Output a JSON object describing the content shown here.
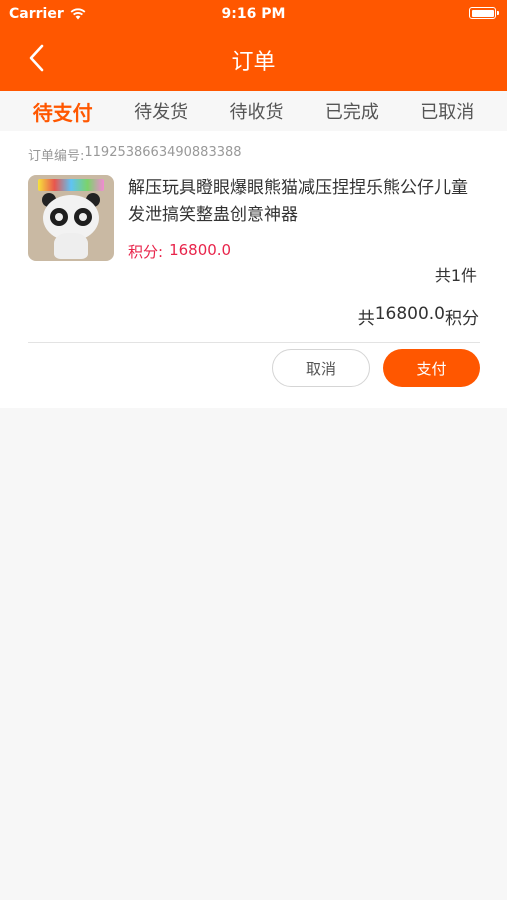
{
  "status_bar": {
    "carrier": "Carrier",
    "time": "9:16 PM"
  },
  "nav": {
    "title": "订单"
  },
  "tabs": [
    {
      "label": "待支付",
      "active": true
    },
    {
      "label": "待发货",
      "active": false
    },
    {
      "label": "待收货",
      "active": false
    },
    {
      "label": "已完成",
      "active": false
    },
    {
      "label": "已取消",
      "active": false
    }
  ],
  "order": {
    "number_label": "订单编号:",
    "number": "1192538663490883388",
    "product_name": "解压玩具瞪眼爆眼熊猫减压捏捏乐熊公仔儿童发泄搞笑整蛊创意神器",
    "points_label": "积分:",
    "points_value": "16800.0",
    "quantity": "共1件",
    "total_prefix": "共",
    "total_value": "16800.0",
    "total_suffix": "积分",
    "cancel_label": "取消",
    "pay_label": "支付"
  },
  "colors": {
    "accent": "#ff5700",
    "points": "#e8254b",
    "background": "#f7f7f7"
  }
}
